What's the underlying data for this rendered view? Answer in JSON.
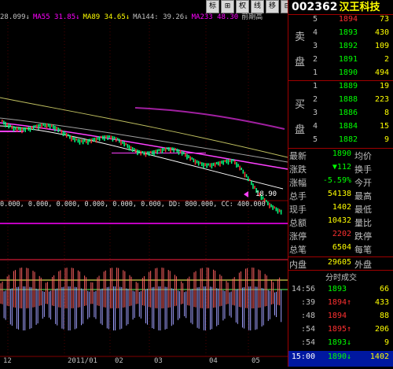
{
  "toolbar": {
    "indicators": [
      {
        "label": "28.099↓",
        "color": "#c0c0c0"
      },
      {
        "label": "MA55  31.85↓",
        "color": "#ff00ff"
      },
      {
        "label": "MA89  34.65↓",
        "color": "#ffff00"
      },
      {
        "label": "MA144: 39.26↓",
        "color": "#c0c0c0"
      },
      {
        "label": "MA233  48.30",
        "color": "#ff00ff"
      },
      {
        "label": "前期高",
        "color": "#c0c0c0"
      }
    ],
    "buttons": [
      "标",
      "⊞",
      "权",
      "线",
      "移",
      "⊟",
      "▤"
    ]
  },
  "chart": {
    "price_marker": "18.90",
    "macd_row": "0.000,  0.000,  0.000,  0.000,  0.000,  0.000,  DD: 800.000,  CC: 400.000",
    "dates": [
      "12",
      "2011/01",
      "02",
      "03",
      "04",
      "05"
    ]
  },
  "stock": {
    "code": "002362",
    "name": "汉王科技"
  },
  "order_book": {
    "sell_label": [
      "卖",
      "盘"
    ],
    "buy_label": [
      "买",
      "盘"
    ],
    "sell": [
      {
        "level": "5",
        "price": "1894",
        "vol": "73",
        "color": "#ff3030"
      },
      {
        "level": "4",
        "price": "1893",
        "vol": "430",
        "color": "#00ff00"
      },
      {
        "level": "3",
        "price": "1892",
        "vol": "109",
        "color": "#00ff00"
      },
      {
        "level": "2",
        "price": "1891",
        "vol": "2",
        "color": "#00ff00"
      },
      {
        "level": "1",
        "price": "1890",
        "vol": "494",
        "color": "#00ff00"
      }
    ],
    "buy": [
      {
        "level": "1",
        "price": "1889",
        "vol": "19",
        "color": "#00ff00"
      },
      {
        "level": "2",
        "price": "1888",
        "vol": "223",
        "color": "#00ff00"
      },
      {
        "level": "3",
        "price": "1886",
        "vol": "8",
        "color": "#00ff00"
      },
      {
        "level": "4",
        "price": "1884",
        "vol": "15",
        "color": "#00ff00"
      },
      {
        "level": "5",
        "price": "1882",
        "vol": "9",
        "color": "#00ff00"
      }
    ]
  },
  "stats": [
    {
      "l1": "最新",
      "v1": "1890",
      "c1": "#00ff00",
      "l2": "均价"
    },
    {
      "l1": "涨跌",
      "v1": "▼112",
      "c1": "#00ff00",
      "l2": "换手"
    },
    {
      "l1": "涨幅",
      "v1": "-5.59%",
      "c1": "#00ff00",
      "l2": "今开"
    },
    {
      "l1": "总手",
      "v1": "54138",
      "c1": "#ffff00",
      "l2": "最高"
    },
    {
      "l1": "现手",
      "v1": "1402",
      "c1": "#ffff00",
      "l2": "最低"
    },
    {
      "l1": "总额",
      "v1": "10432",
      "c1": "#ffff00",
      "l2": "量比"
    },
    {
      "l1": "涨停",
      "v1": "2202",
      "c1": "#ff3030",
      "l2": "跌停"
    },
    {
      "l1": "总笔",
      "v1": "6504",
      "c1": "#ffff00",
      "l2": "每笔"
    }
  ],
  "inout": {
    "l1": "内盘",
    "v1": "29605",
    "l2": "外盘"
  },
  "trades_title": "分时成交",
  "trades": [
    {
      "time": "14:56",
      "price": "1893",
      "arrow": "",
      "vol": "66",
      "color": "#00ff00"
    },
    {
      "time": ":39",
      "price": "1894",
      "arrow": "↑",
      "vol": "433",
      "color": "#ff3030"
    },
    {
      "time": ":48",
      "price": "1894",
      "arrow": "",
      "vol": "88",
      "color": "#ff3030"
    },
    {
      "time": ":54",
      "price": "1895",
      "arrow": "↑",
      "vol": "206",
      "color": "#ff3030"
    },
    {
      "time": ":54",
      "price": "1893",
      "arrow": "↓",
      "vol": "9",
      "color": "#00ff00"
    }
  ],
  "last_trade": {
    "time": "15:00",
    "price": "1890",
    "arrow": "↓",
    "vol": "1402"
  }
}
